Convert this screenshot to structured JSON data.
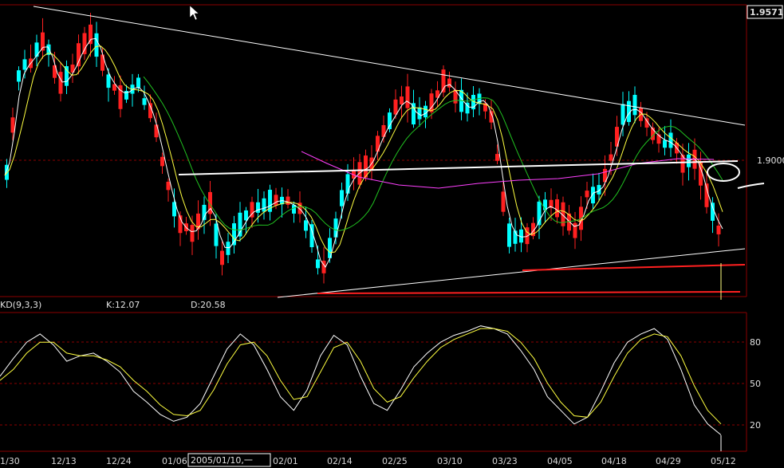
{
  "price_panel": {
    "last_price": "1.9571",
    "ref_level": "1.9000"
  },
  "kd_panel": {
    "indicator": "KD(9,3,3)",
    "k_text": "K:12.07",
    "d_text": "D:20.58",
    "levels": [
      "80",
      "50",
      "20"
    ]
  },
  "x_axis": {
    "dates": [
      "1/30",
      "12/13",
      "12/24",
      "01/06",
      "02/01",
      "02/14",
      "02/25",
      "03/10",
      "03/23",
      "04/05",
      "04/18",
      "04/29",
      "05/12"
    ],
    "cursor_date": "2005/01/10,一"
  },
  "colors": {
    "background": "#000000",
    "up_candle": "#ff2020",
    "down_candle": "#00ffff",
    "grid": "#8b0000",
    "ma_short": "#ffffff",
    "ma_mid": "#ffff40",
    "ma_long": "#20c020",
    "ma_longest": "#ff40ff",
    "k_line": "#ffffff",
    "d_line": "#ffff40",
    "trend_line": "#ffffff",
    "support_line": "#ff2020"
  },
  "chart_data": {
    "type": "candlestick",
    "instrument_price_label": "1.9571",
    "y_ref": 1.9,
    "candles_approx_count": 120,
    "kd": {
      "params": [
        9,
        3,
        3
      ],
      "k_last": 12.07,
      "d_last": 20.58,
      "k_approx": [
        55,
        68,
        80,
        86,
        78,
        66,
        70,
        72,
        66,
        58,
        44,
        36,
        27,
        22,
        25,
        35,
        55,
        75,
        86,
        78,
        60,
        40,
        30,
        45,
        70,
        85,
        78,
        55,
        35,
        30,
        45,
        62,
        72,
        80,
        85,
        88,
        92,
        90,
        86,
        74,
        60,
        40,
        30,
        20,
        25,
        44,
        65,
        80,
        86,
        90,
        82,
        60,
        34,
        20,
        12
      ],
      "d_approx": [
        52,
        60,
        72,
        80,
        80,
        72,
        70,
        70,
        67,
        62,
        52,
        44,
        34,
        27,
        26,
        30,
        45,
        64,
        78,
        80,
        70,
        52,
        38,
        40,
        58,
        76,
        80,
        66,
        46,
        36,
        40,
        54,
        66,
        76,
        82,
        86,
        90,
        90,
        88,
        80,
        68,
        50,
        36,
        26,
        25,
        36,
        55,
        72,
        82,
        86,
        84,
        70,
        48,
        30,
        20
      ]
    }
  }
}
